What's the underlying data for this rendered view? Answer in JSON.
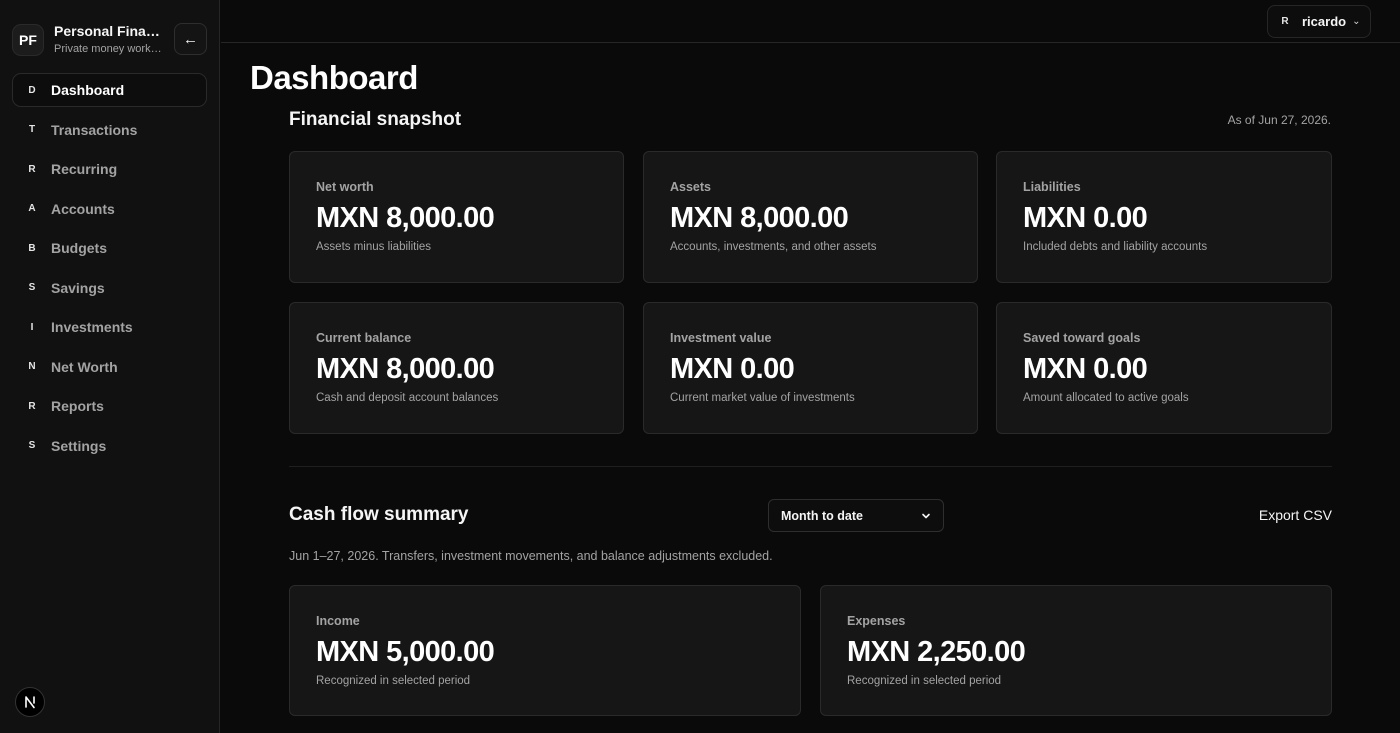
{
  "sidebar": {
    "brand": {
      "logo_text": "PF",
      "name": "Personal Finance",
      "subtitle": "Private money workspace"
    },
    "collapse_icon": "arrow-left-icon",
    "items": [
      {
        "letter": "D",
        "label": "Dashboard",
        "active": true
      },
      {
        "letter": "T",
        "label": "Transactions"
      },
      {
        "letter": "R",
        "label": "Recurring"
      },
      {
        "letter": "A",
        "label": "Accounts"
      },
      {
        "letter": "B",
        "label": "Budgets"
      },
      {
        "letter": "S",
        "label": "Savings"
      },
      {
        "letter": "I",
        "label": "Investments"
      },
      {
        "letter": "N",
        "label": "Net Worth"
      },
      {
        "letter": "R",
        "label": "Reports"
      },
      {
        "letter": "S",
        "label": "Settings"
      }
    ],
    "footer_badge": "N"
  },
  "topbar": {
    "user": {
      "avatar": "R",
      "name": "ricardo",
      "caret_icon": "chevron-down-icon"
    }
  },
  "page": {
    "title": "Dashboard"
  },
  "snapshot": {
    "title": "Financial snapshot",
    "as_of": "As of Jun 27, 2026.",
    "cards": [
      {
        "label": "Net worth",
        "value": "MXN 8,000.00",
        "desc": "Assets minus liabilities"
      },
      {
        "label": "Assets",
        "value": "MXN 8,000.00",
        "desc": "Accounts, investments, and other assets"
      },
      {
        "label": "Liabilities",
        "value": "MXN 0.00",
        "desc": "Included debts and liability accounts"
      },
      {
        "label": "Current balance",
        "value": "MXN 8,000.00",
        "desc": "Cash and deposit account balances"
      },
      {
        "label": "Investment value",
        "value": "MXN 0.00",
        "desc": "Current market value of investments"
      },
      {
        "label": "Saved toward goals",
        "value": "MXN 0.00",
        "desc": "Amount allocated to active goals"
      }
    ]
  },
  "cashflow": {
    "title": "Cash flow summary",
    "period_select": {
      "value": "Month to date"
    },
    "export_label": "Export CSV",
    "note": "Jun 1–27, 2026. Transfers, investment movements, and balance adjustments excluded.",
    "cards": [
      {
        "label": "Income",
        "value": "MXN 5,000.00",
        "desc": "Recognized in selected period"
      },
      {
        "label": "Expenses",
        "value": "MXN 2,250.00",
        "desc": "Recognized in selected period"
      }
    ]
  }
}
